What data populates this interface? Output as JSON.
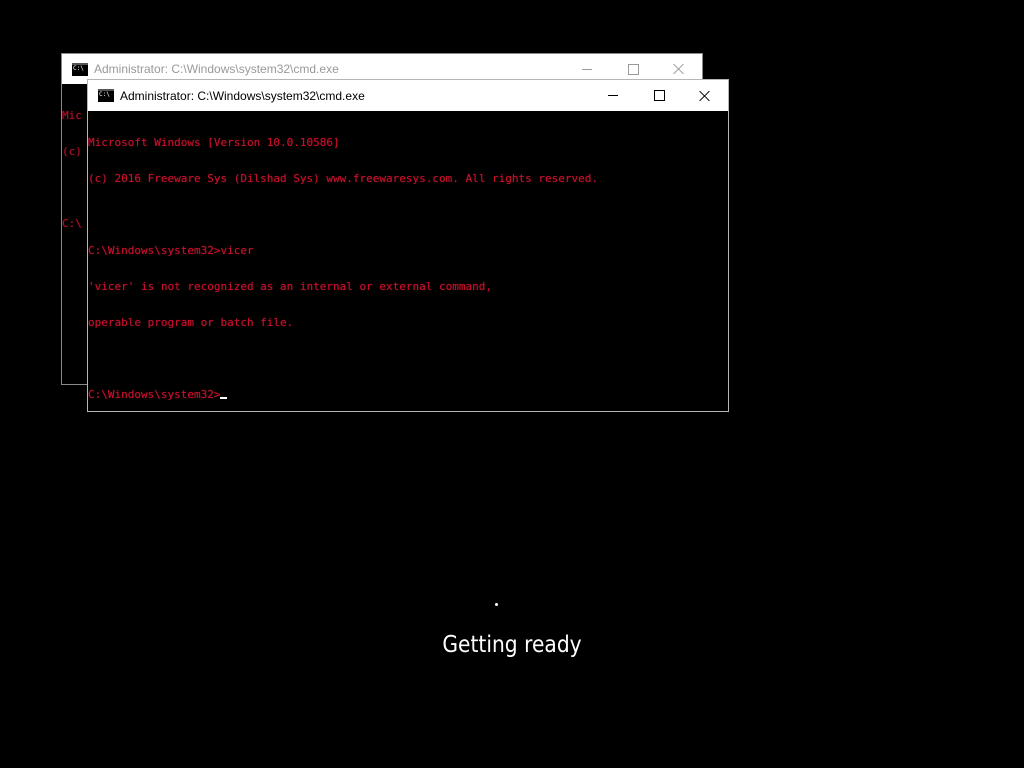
{
  "back_window": {
    "title": "Administrator: C:\\Windows\\system32\\cmd.exe",
    "console_lines": [
      "Mic",
      "(c)",
      "",
      "C:\\"
    ]
  },
  "front_window": {
    "title": "Administrator: C:\\Windows\\system32\\cmd.exe",
    "console_lines": [
      "Microsoft Windows [Version 10.0.10586]",
      "(c) 2016 Freeware Sys (Dilshad Sys) www.freewaresys.com. All rights reserved.",
      "",
      "C:\\Windows\\system32>vicer",
      "'vicer' is not recognized as an internal or external command,",
      "operable program or batch file.",
      "",
      "C:\\Windows\\system32>"
    ]
  },
  "boot_status": {
    "text": "Getting ready"
  },
  "colors": {
    "console_text": "#c8102e",
    "background": "#000000",
    "titlebar": "#ffffff"
  },
  "icons": {
    "window_icon": "cmd-icon",
    "minimize": "minimize-icon",
    "maximize": "maximize-icon",
    "close": "close-icon",
    "progress": "loading-dot-icon"
  }
}
